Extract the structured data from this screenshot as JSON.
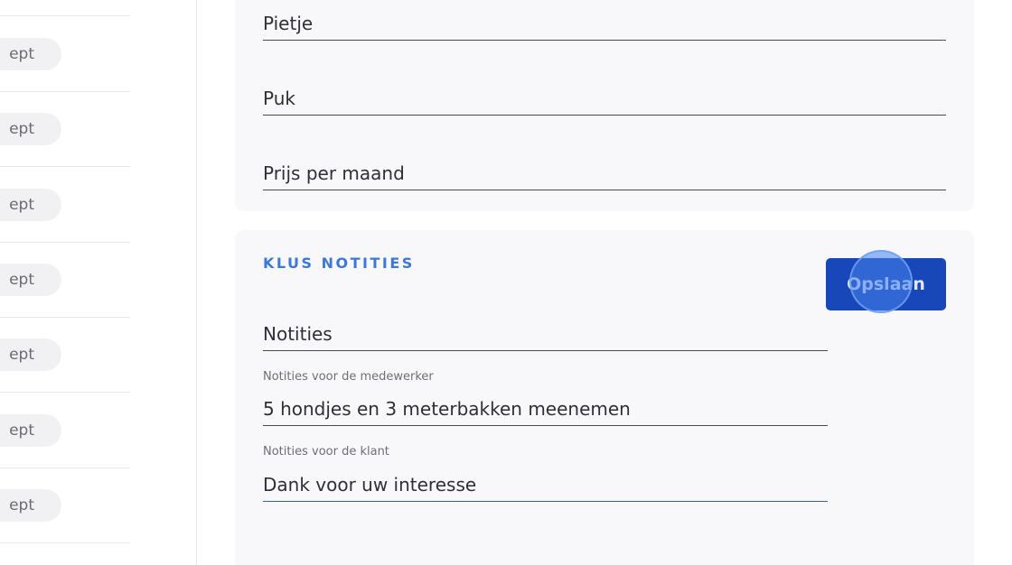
{
  "sidebar": {
    "badges": [
      {
        "label": "ept"
      },
      {
        "label": "ept"
      },
      {
        "label": "ept"
      },
      {
        "label": "ept"
      },
      {
        "label": "ept"
      },
      {
        "label": "ept"
      },
      {
        "label": "ept"
      }
    ]
  },
  "customer": {
    "first_name": "Pietje",
    "last_name": "Puk",
    "price_per_month_placeholder": "Prijs per maand"
  },
  "notes": {
    "section_title": "KLUS NOTITIES",
    "save_label": "Opslaan",
    "notes_placeholder": "Notities",
    "employee_notes_label": "Notities voor de medewerker",
    "employee_notes_value": "5 hondjes en 3 meterbakken meenemen",
    "client_notes_label": "Notities voor de klant",
    "client_notes_value": "Dank voor uw interesse"
  },
  "colors": {
    "accent": "#3b78d8",
    "button": "#1747b8"
  }
}
